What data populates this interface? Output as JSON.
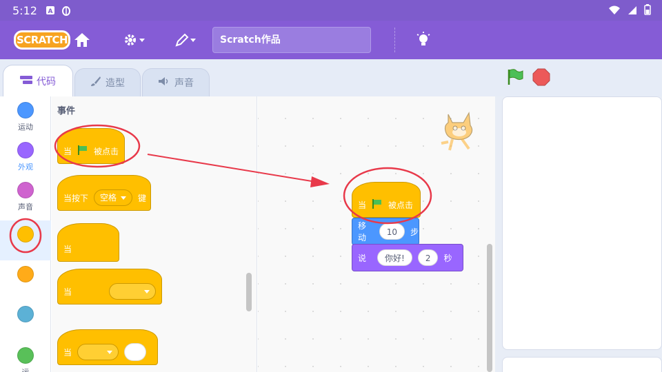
{
  "status_bar": {
    "time": "5:12"
  },
  "menu_bar": {
    "logo_text": "SCRATCH",
    "project_title": "Scratch作品"
  },
  "tabs": [
    {
      "label": "代码",
      "active": true
    },
    {
      "label": "造型",
      "active": false
    },
    {
      "label": "声音",
      "active": false
    }
  ],
  "categories": [
    {
      "label": "运动",
      "color": "#4c97ff"
    },
    {
      "label": "外观",
      "color": "#9966ff"
    },
    {
      "label": "声音",
      "color": "#cf63cf"
    },
    {
      "label": "",
      "color": "#ffbf00",
      "selected": true
    },
    {
      "label": "",
      "color": "#ffab19"
    },
    {
      "label": "",
      "color": "#5cb1d6"
    },
    {
      "label": "运",
      "color": "#59c059"
    }
  ],
  "palette": {
    "title": "事件",
    "blocks": {
      "when_flag": {
        "prefix": "当",
        "suffix": "被点击"
      },
      "when_key": {
        "prefix": "当按下",
        "key": "空格",
        "suffix": "键"
      },
      "when_backdrop": {
        "prefix": "当"
      },
      "when_sensor": {
        "prefix": "当"
      },
      "when_greater": {
        "prefix": "当"
      }
    }
  },
  "script": {
    "hat": {
      "prefix": "当",
      "suffix": "被点击"
    },
    "move": {
      "label": "移动",
      "steps": "10",
      "unit": "步"
    },
    "say": {
      "label": "说",
      "message": "你好!",
      "seconds": "2",
      "unit": "秒"
    }
  },
  "colors": {
    "menu_purple": "#855cd6",
    "events_yellow": "#ffbf00",
    "motion_blue": "#4c97ff",
    "looks_purple": "#9966ff",
    "annotation_red": "#e8394a"
  }
}
